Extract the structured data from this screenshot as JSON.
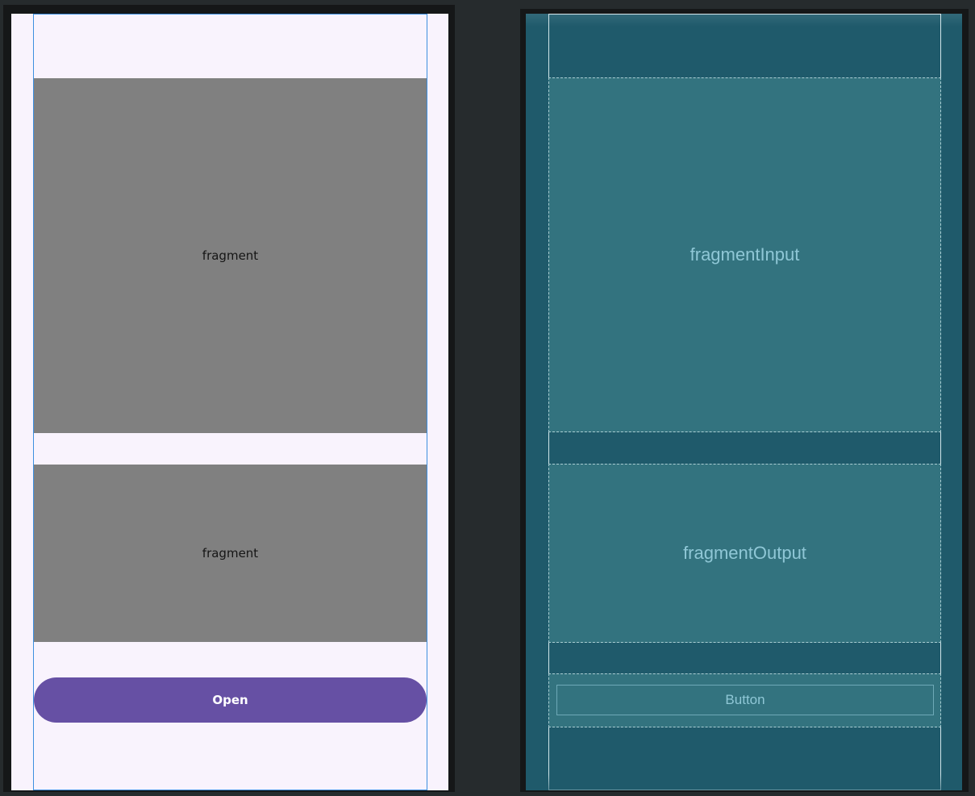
{
  "design_view": {
    "fragment_input": {
      "label": "fragment"
    },
    "fragment_output": {
      "label": "fragment"
    },
    "open_button": {
      "label": "Open"
    }
  },
  "blueprint_view": {
    "fragment_input": {
      "label": "fragmentInput"
    },
    "fragment_output": {
      "label": "fragmentOutput"
    },
    "button": {
      "label": "Button"
    }
  },
  "colors": {
    "workspace_background": "#262b2d",
    "design_background": "#f9f3fd",
    "fragment_fill": "#808080",
    "button_fill": "#6650a4",
    "blueprint_background": "#1f5a6b",
    "blueprint_component": "#33737f",
    "blueprint_text": "#8fc7d6"
  }
}
